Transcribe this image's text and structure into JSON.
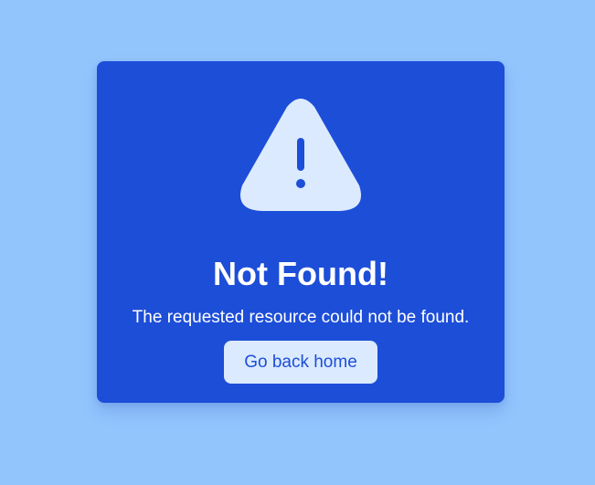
{
  "error": {
    "title": "Not Found!",
    "message": "The requested resource could not be found.",
    "home_button_label": "Go back home",
    "icon": "warning-triangle-icon"
  },
  "colors": {
    "background": "#93c5fd",
    "card": "#1d4ed8",
    "text": "#ffffff",
    "icon_fill": "#dbeafe",
    "button_bg": "#dbeafe",
    "button_text": "#1d4ed8"
  }
}
